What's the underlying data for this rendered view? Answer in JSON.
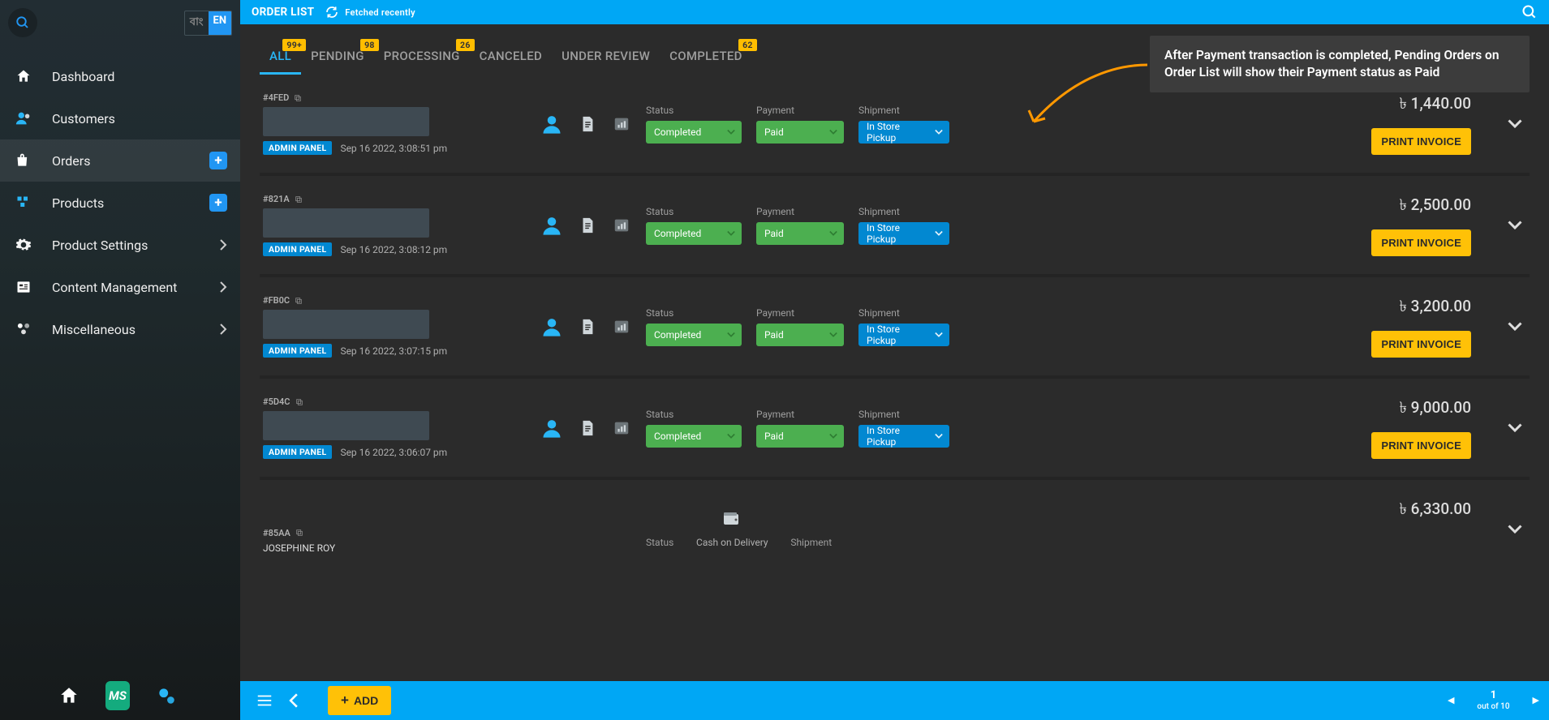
{
  "lang": {
    "alt": "বাং",
    "current": "EN"
  },
  "sidebar": {
    "items": [
      {
        "label": "Dashboard"
      },
      {
        "label": "Customers"
      },
      {
        "label": "Orders"
      },
      {
        "label": "Products"
      },
      {
        "label": "Product Settings"
      },
      {
        "label": "Content Management"
      },
      {
        "label": "Miscellaneous"
      }
    ],
    "bottom_brand": "MS"
  },
  "header": {
    "title": "ORDER LIST",
    "refresh_text": "Fetched recently"
  },
  "tabs": [
    {
      "label": "ALL",
      "badge": "99+"
    },
    {
      "label": "PENDING",
      "badge": "98"
    },
    {
      "label": "PROCESSING",
      "badge": "26"
    },
    {
      "label": "CANCELED"
    },
    {
      "label": "UNDER REVIEW"
    },
    {
      "label": "COMPLETED",
      "badge": "62"
    }
  ],
  "annotation": "After Payment transaction is completed, Pending Orders on Order List will show their Payment status as Paid",
  "labels": {
    "status": "Status",
    "payment": "Payment",
    "shipment": "Shipment",
    "admin_panel": "ADMIN PANEL",
    "print_invoice": "PRINT INVOICE",
    "cod": "Cash on Delivery"
  },
  "dropdown_values": {
    "completed": "Completed",
    "paid": "Paid",
    "in_store_pickup": "In Store Pickup"
  },
  "orders": [
    {
      "id": "#4FED",
      "datetime": "Sep 16 2022, 3:08:51 pm",
      "price": "৳ 1,440.00",
      "show_customer_box": true
    },
    {
      "id": "#821A",
      "datetime": "Sep 16 2022, 3:08:12 pm",
      "price": "৳ 2,500.00",
      "show_customer_box": true
    },
    {
      "id": "#FB0C",
      "datetime": "Sep 16 2022, 3:07:15 pm",
      "price": "৳ 3,200.00",
      "show_customer_box": true
    },
    {
      "id": "#5D4C",
      "datetime": "Sep 16 2022, 3:06:07 pm",
      "price": "৳ 9,000.00",
      "show_customer_box": true
    }
  ],
  "last_order": {
    "id": "#85AA",
    "customer": "JOSEPHINE ROY",
    "price": "৳ 6,330.00"
  },
  "footer": {
    "add_label": "ADD",
    "page_current": "1",
    "page_total": "out of 10"
  }
}
